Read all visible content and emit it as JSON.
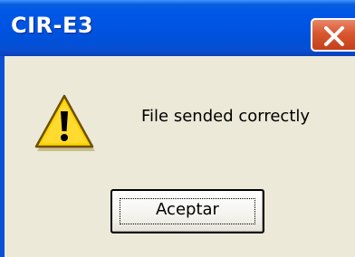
{
  "window": {
    "title": "CIR-E3"
  },
  "titlebar": {
    "close_icon": "close-icon"
  },
  "dialog": {
    "icon": "warning-icon",
    "message": "File sended correctly",
    "ok_label": "Aceptar"
  },
  "colors": {
    "titlebar": "#0054e3",
    "close_button": "#d8582f",
    "client_background": "#ece9d8",
    "warning_yellow": "#ffd200"
  }
}
